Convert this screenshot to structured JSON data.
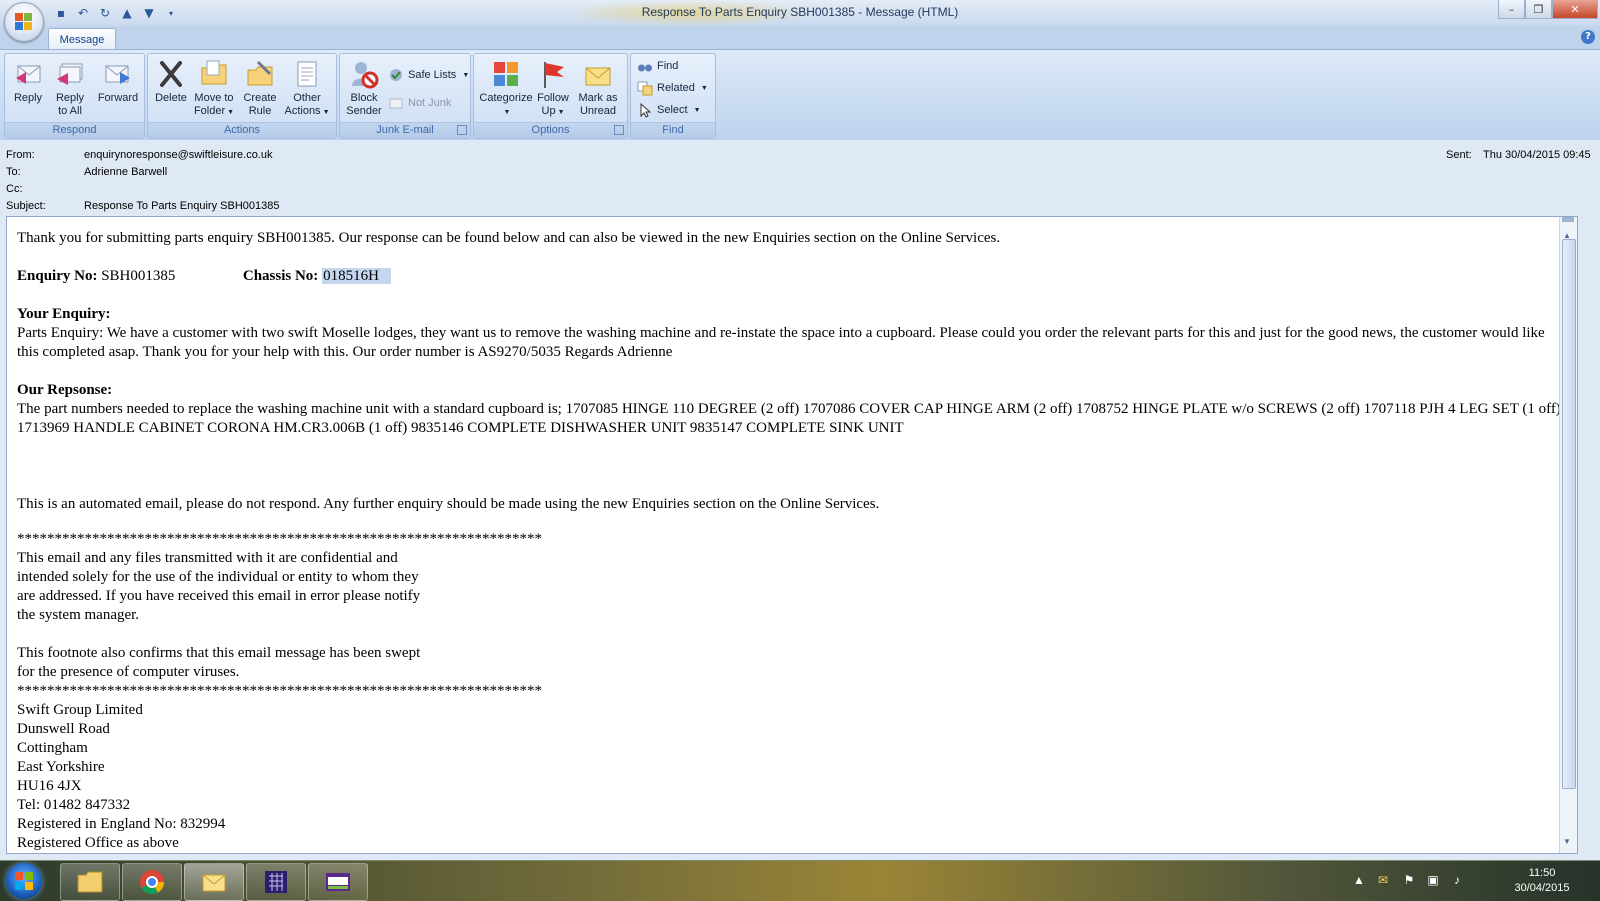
{
  "window": {
    "title": "Response To Parts Enquiry SBH001385 - Message (HTML)",
    "minimize": "–",
    "maximize": "❐",
    "close": "✕"
  },
  "ribbon": {
    "tab": "Message",
    "help": "?",
    "groups": {
      "respond": {
        "label": "Respond",
        "reply": "Reply",
        "reply_all_1": "Reply",
        "reply_all_2": "to All",
        "forward": "Forward"
      },
      "actions": {
        "label": "Actions",
        "delete": "Delete",
        "move_1": "Move to",
        "move_2": "Folder",
        "create_1": "Create",
        "create_2": "Rule",
        "other_1": "Other",
        "other_2": "Actions"
      },
      "junk": {
        "label": "Junk E-mail",
        "block_1": "Block",
        "block_2": "Sender",
        "safe_lists": "Safe Lists",
        "not_junk": "Not Junk"
      },
      "options": {
        "label": "Options",
        "categorize": "Categorize",
        "follow_1": "Follow",
        "follow_2": "Up",
        "mark_1": "Mark as",
        "mark_2": "Unread"
      },
      "find": {
        "label": "Find",
        "find": "Find",
        "related": "Related",
        "select": "Select"
      }
    }
  },
  "header": {
    "from_label": "From:",
    "from": "enquirynoresponse@swiftleisure.co.uk",
    "to_label": "To:",
    "to": "Adrienne Barwell",
    "cc_label": "Cc:",
    "cc": "",
    "subject_label": "Subject:",
    "subject": "Response To Parts Enquiry SBH001385",
    "sent_label": "Sent:",
    "sent": "Thu 30/04/2015 09:45"
  },
  "body": {
    "intro": "Thank you for submitting parts enquiry SBH001385. Our response can be found below and can also be viewed in the new Enquiries section on the Online Services.",
    "enquiry_no_label": "Enquiry No:",
    "enquiry_no": "SBH001385",
    "chassis_label": "Chassis No:",
    "chassis": "018516H",
    "your_enquiry_label": "Your Enquiry:",
    "your_enquiry": "Parts Enquiry: We have a customer with two swift Moselle lodges, they want us to remove the washing machine and re-instate the space into a cupboard. Please could you order the relevant parts for this and just for the good news, the customer would like this completed asap. Thank you for your help with this. Our order number is AS9270/5035 Regards Adrienne",
    "response_label": "Our Repsonse:",
    "response": "The part numbers needed to replace the washing machine unit with a standard cupboard is; 1707085 HINGE 110 DEGREE (2 off) 1707086 COVER CAP HINGE ARM (2 off) 1708752 HINGE PLATE w/o SCREWS (2 off) 1707118 PJH 4 LEG SET (1 off) 1713969 HANDLE CABINET CORONA HM.CR3.006B (1 off) 9835146 COMPLETE DISHWASHER UNIT 9835147 COMPLETE SINK UNIT",
    "automated": "This is an automated email, please do not respond. Any further enquiry should be made using the new Enquiries section on the Online Services.",
    "stars": "**********************************************************************",
    "disclaimer_1": "This email and any files transmitted with it are confidential and",
    "disclaimer_2": "intended solely for the use of the individual or entity to whom they",
    "disclaimer_3": "are addressed. If you have received this email in error please notify",
    "disclaimer_4": "the system manager.",
    "footnote_1": "This footnote also confirms that this email message has been swept",
    "footnote_2": "for the presence of computer viruses.",
    "address": [
      "Swift Group Limited",
      "Dunswell Road",
      "Cottingham",
      "East Yorkshire",
      "HU16 4JX",
      "Tel: 01482 847332",
      "Registered in England No: 832994",
      "Registered Office as above"
    ]
  },
  "taskbar": {
    "time": "11:50",
    "date": "30/04/2015",
    "apps": [
      "windows-explorer-icon",
      "chrome-icon",
      "outlook-icon",
      "calendar-app-icon",
      "sage-icon"
    ]
  },
  "colors": {
    "ribbon_bg": "#c7daf1",
    "highlight": "#c5d7ee",
    "close_button": "#c7452b"
  }
}
